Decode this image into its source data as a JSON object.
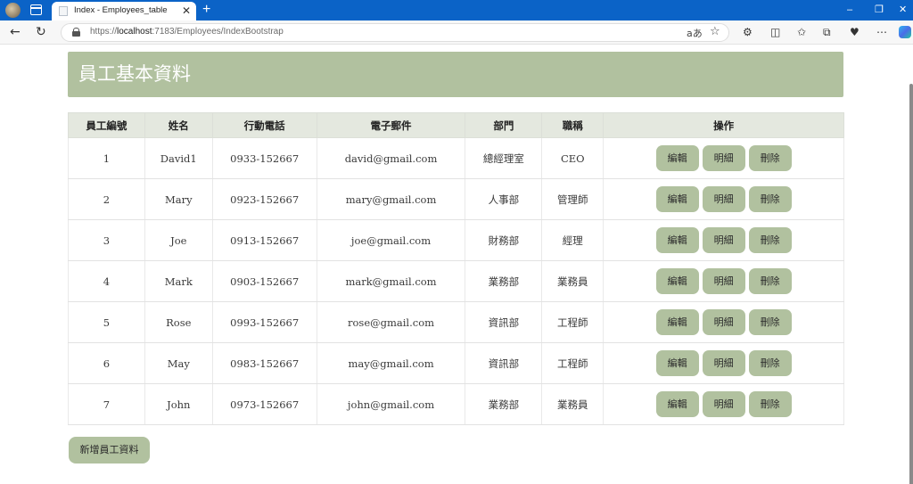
{
  "browser": {
    "tab_title": "Index - Employees_table",
    "tab_close": "✕",
    "new_tab": "+",
    "url_scheme": "https://",
    "url_host": "localhost",
    "url_path": ":7183/Employees/IndexBootstrap",
    "window_controls": {
      "minimize": "–",
      "restore": "❐",
      "close": "✕"
    }
  },
  "page": {
    "title": "員工基本資料",
    "columns": [
      "員工編號",
      "姓名",
      "行動電話",
      "電子郵件",
      "部門",
      "職稱",
      "操作"
    ],
    "rows": [
      {
        "id": "1",
        "name": "David1",
        "phone": "0933-152667",
        "email": "david@gmail.com",
        "dept": "總經理室",
        "title": "CEO"
      },
      {
        "id": "2",
        "name": "Mary",
        "phone": "0923-152667",
        "email": "mary@gmail.com",
        "dept": "人事部",
        "title": "管理師"
      },
      {
        "id": "3",
        "name": "Joe",
        "phone": "0913-152667",
        "email": "joe@gmail.com",
        "dept": "財務部",
        "title": "經理"
      },
      {
        "id": "4",
        "name": "Mark",
        "phone": "0903-152667",
        "email": "mark@gmail.com",
        "dept": "業務部",
        "title": "業務員"
      },
      {
        "id": "5",
        "name": "Rose",
        "phone": "0993-152667",
        "email": "rose@gmail.com",
        "dept": "資訊部",
        "title": "工程師"
      },
      {
        "id": "6",
        "name": "May",
        "phone": "0983-152667",
        "email": "may@gmail.com",
        "dept": "資訊部",
        "title": "工程師"
      },
      {
        "id": "7",
        "name": "John",
        "phone": "0973-152667",
        "email": "john@gmail.com",
        "dept": "業務部",
        "title": "業務員"
      }
    ],
    "actions": {
      "edit": "編輯",
      "details": "明細",
      "delete": "刪除"
    },
    "add_button": "新增員工資料"
  },
  "colors": {
    "accent": "#b1c19f",
    "table_header": "#e4e8df",
    "titlebar": "#0b63c7"
  }
}
